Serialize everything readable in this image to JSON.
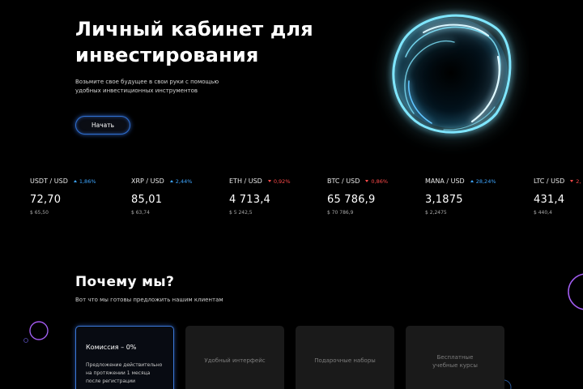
{
  "hero": {
    "title_line1": "Личный кабинет для",
    "title_line2": "инвестирования",
    "subtitle_line1": "Возьмите свое будущее в свои руки с помощью",
    "subtitle_line2": "удобных инвестиционных инструментов",
    "start_button": "Начать"
  },
  "tickers": [
    {
      "pair": "USDT / USD",
      "change": "1,86%",
      "direction": "up",
      "price": "72,70",
      "sub": "$ 65,50"
    },
    {
      "pair": "XRP / USD",
      "change": "2,44%",
      "direction": "up",
      "price": "85,01",
      "sub": "$ 63,74"
    },
    {
      "pair": "ETH / USD",
      "change": "0,92%",
      "direction": "down",
      "price": "4 713,4",
      "sub": "$ 5 242,5"
    },
    {
      "pair": "BTC / USD",
      "change": "0,86%",
      "direction": "down",
      "price": "65 786,9",
      "sub": "$ 70 786,9"
    },
    {
      "pair": "MANA / USD",
      "change": "28,24%",
      "direction": "up",
      "price": "3,1875",
      "sub": "$ 2,2475"
    },
    {
      "pair": "LTC / USD",
      "change": "2,",
      "direction": "down",
      "price": "431,4",
      "sub": "$ 440,4"
    }
  ],
  "why": {
    "title": "Почему мы?",
    "subtitle": "Вот что мы готовы предложить нашим клиентам"
  },
  "cards": {
    "commission": {
      "title": "Комиссия – 0%",
      "desc_line1": "Предложение действительно",
      "desc_line2": "на протяжении 1 месяца",
      "desc_line3": "после регистрации"
    },
    "interface": "Удобный интерфейс",
    "gifts": "Подарочные наборы",
    "courses_line1": "Бесплатные",
    "courses_line2": "учебные курсы"
  },
  "colors": {
    "background": "#000000",
    "accent_blue": "#3ea6ff",
    "down_red": "#ff4a4a",
    "glow_cyan": "#7fe6ff",
    "decor_pink": "#c23cff"
  }
}
